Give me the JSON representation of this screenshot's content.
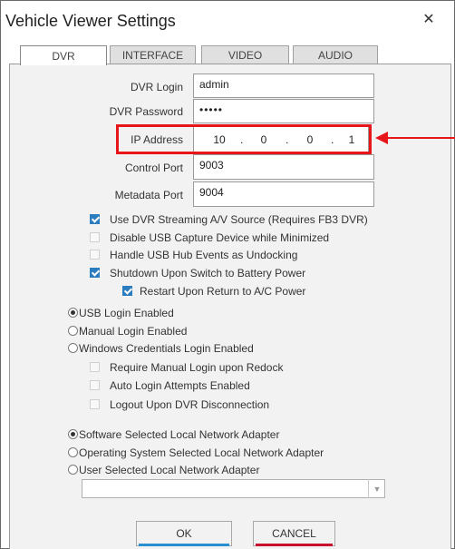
{
  "window": {
    "title": "Vehicle Viewer Settings",
    "close_glyph": "✕"
  },
  "tabs": [
    {
      "label": "DVR",
      "active": true
    },
    {
      "label": "INTERFACE",
      "active": false
    },
    {
      "label": "VIDEO",
      "active": false
    },
    {
      "label": "AUDIO",
      "active": false
    }
  ],
  "dvr": {
    "login_label": "DVR Login",
    "login_value": "admin",
    "password_label": "DVR Password",
    "password_value": "•••••",
    "ip_label": "IP Address",
    "ip_segments": [
      "10",
      "0",
      "0",
      "1"
    ],
    "ip_separator": ".",
    "control_port_label": "Control Port",
    "control_port_value": "9003",
    "metadata_port_label": "Metadata Port",
    "metadata_port_value": "9004"
  },
  "checkboxes": [
    {
      "label": "Use DVR Streaming A/V Source (Requires FB3 DVR)",
      "checked": true
    },
    {
      "label": "Disable USB Capture Device while Minimized",
      "checked": false
    },
    {
      "label": "Handle USB Hub Events as Undocking",
      "checked": false
    },
    {
      "label": "Shutdown Upon Switch to Battery Power",
      "checked": true
    },
    {
      "label": "Restart Upon Return to A/C Power",
      "checked": true
    }
  ],
  "login_mode": {
    "options": [
      "USB Login Enabled",
      "Manual Login Enabled",
      "Windows Credentials Login Enabled"
    ],
    "selected": "USB Login Enabled",
    "sub_options": [
      {
        "label": "Require Manual Login upon Redock",
        "checked": false
      },
      {
        "label": "Auto Login Attempts Enabled",
        "checked": false
      },
      {
        "label": "Logout Upon DVR Disconnection",
        "checked": false
      }
    ]
  },
  "network_adapter": {
    "options": [
      "Software Selected Local Network Adapter",
      "Operating System Selected Local Network Adapter",
      "User Selected Local Network Adapter"
    ],
    "selected": "Software Selected Local Network Adapter",
    "dropdown_value": ""
  },
  "buttons": {
    "ok_label": "OK",
    "cancel_label": "CANCEL",
    "ok_accent": "#2a8fd0",
    "cancel_accent": "#c8102e"
  },
  "annotation": {
    "highlight_color": "#e8151b",
    "target": "IP Address"
  }
}
